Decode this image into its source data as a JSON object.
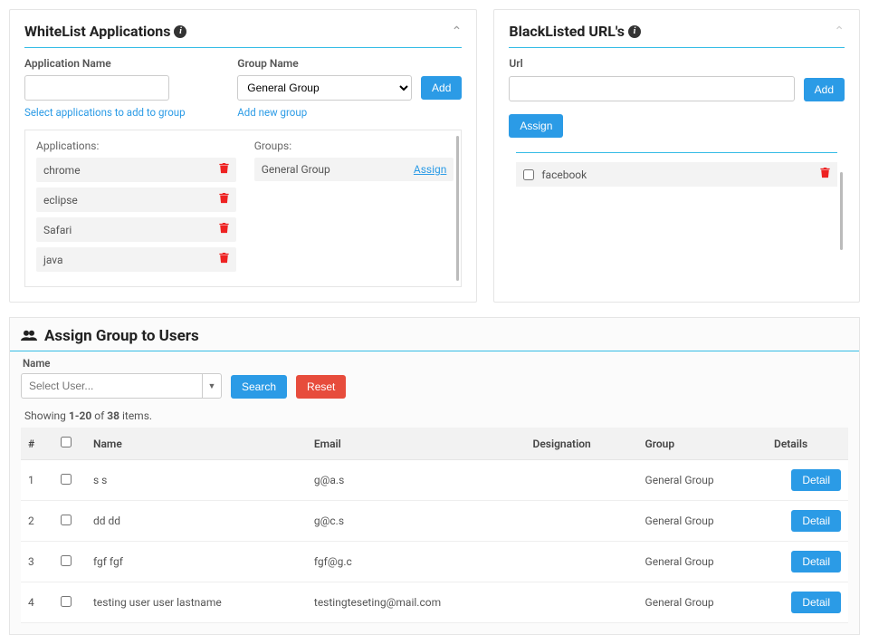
{
  "whitelist": {
    "title": "WhiteList Applications",
    "appname_label": "Application Name",
    "groupname_label": "Group Name",
    "group_selected": "General Group",
    "add_label": "Add",
    "link_select_apps": "Select applications to add to group",
    "link_add_group": "Add new group",
    "apps_heading": "Applications:",
    "groups_heading": "Groups:",
    "apps": [
      "chrome",
      "eclipse",
      "Safari",
      "java"
    ],
    "group_item": {
      "name": "General Group",
      "action": "Assign"
    }
  },
  "blacklist": {
    "title": "BlackListed URL's",
    "url_label": "Url",
    "add_label": "Add",
    "assign_label": "Assign",
    "items": [
      "facebook"
    ]
  },
  "assign": {
    "title": "Assign Group to Users",
    "name_label": "Name",
    "select_placeholder": "Select User...",
    "search_label": "Search",
    "reset_label": "Reset",
    "showing_prefix": "Showing ",
    "showing_range": "1-20",
    "showing_mid": " of ",
    "showing_total": "38",
    "showing_suffix": " items.",
    "columns": {
      "num": "#",
      "name": "Name",
      "email": "Email",
      "designation": "Designation",
      "group": "Group",
      "details": "Details"
    },
    "detail_label": "Detail",
    "rows": [
      {
        "n": "1",
        "name": "s s",
        "email": "g@a.s",
        "designation": "",
        "group": "General Group"
      },
      {
        "n": "2",
        "name": "dd dd",
        "email": "g@c.s",
        "designation": "",
        "group": "General Group"
      },
      {
        "n": "3",
        "name": "fgf fgf",
        "email": "fgf@g.c",
        "designation": "",
        "group": "General Group"
      },
      {
        "n": "4",
        "name": "testing user user lastname",
        "email": "testingteseting@mail.com",
        "designation": "",
        "group": "General Group"
      }
    ]
  }
}
